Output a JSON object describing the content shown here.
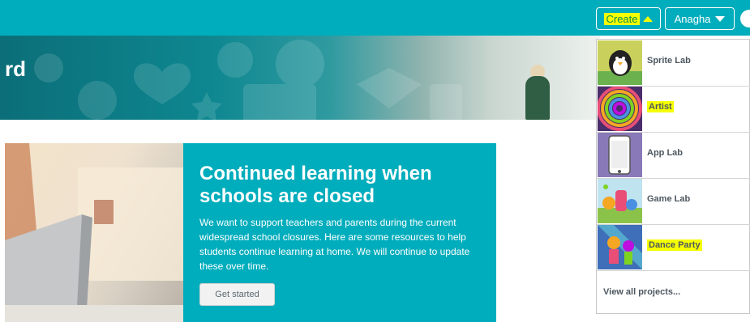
{
  "header": {
    "create_label": "Create",
    "user_name": "Anagha"
  },
  "hero": {
    "title_fragment": "rd"
  },
  "card": {
    "heading": "Continued learning when schools are closed",
    "body": "We want to support teachers and parents during the current widespread school closures. Here are some resources to help students continue learning at home. We will continue to update these over time.",
    "button_label": "Get started"
  },
  "create_menu": {
    "items": [
      {
        "label": "Sprite Lab",
        "icon": "sprite-lab-thumbnail"
      },
      {
        "label": "Artist",
        "icon": "artist-thumbnail"
      },
      {
        "label": "App Lab",
        "icon": "app-lab-thumbnail"
      },
      {
        "label": "Game Lab",
        "icon": "game-lab-thumbnail"
      },
      {
        "label": "Dance Party",
        "icon": "dance-party-thumbnail"
      }
    ],
    "view_all": "View all projects..."
  },
  "colors": {
    "brand_teal": "#00adbc",
    "highlight": "#f6ff00"
  }
}
